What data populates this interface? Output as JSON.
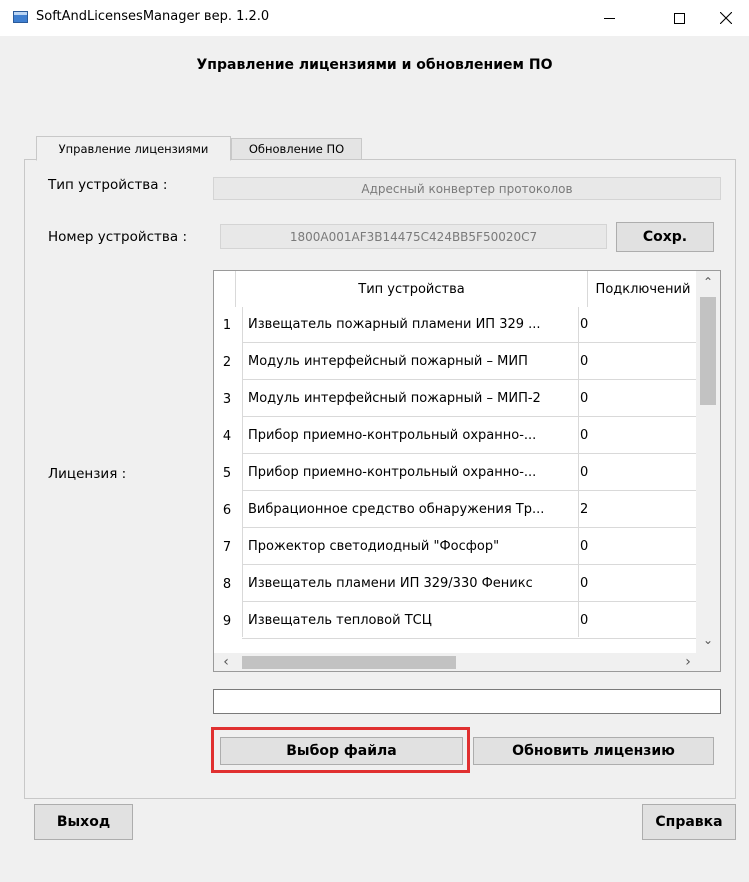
{
  "window": {
    "title": "SoftAndLicensesManager вер. 1.2.0"
  },
  "header": {
    "title": "Управление лицензиями и обновлением ПО"
  },
  "tabs": [
    {
      "label": "Управление лицензиями",
      "active": true
    },
    {
      "label": "Обновление ПО",
      "active": false
    }
  ],
  "form": {
    "device_type_label": "Тип устройства :",
    "device_type_value": "Адресный конвертер протоколов",
    "device_number_label": "Номер устройства :",
    "device_number_value": "1800A001AF3B14475C424BB5F50020C7",
    "save_label": "Сохр.",
    "license_label": "Лицензия :",
    "file_path_value": ""
  },
  "license_table": {
    "columns": [
      "Тип устройства",
      "Подключений"
    ],
    "rows": [
      {
        "n": "1",
        "type": "Извещатель пожарный пламени ИП 329 ...",
        "connections": "0"
      },
      {
        "n": "2",
        "type": "Модуль интерфейсный пожарный – МИП",
        "connections": "0"
      },
      {
        "n": "3",
        "type": "Модуль интерфейсный пожарный – МИП-2",
        "connections": "0"
      },
      {
        "n": "4",
        "type": "Прибор приемно-контрольный охранно-...",
        "connections": "0"
      },
      {
        "n": "5",
        "type": "Прибор приемно-контрольный охранно-...",
        "connections": "0"
      },
      {
        "n": "6",
        "type": "Вибрационное средство обнаружения Тр...",
        "connections": "2"
      },
      {
        "n": "7",
        "type": "Прожектор светодиодный \"Фосфор\"",
        "connections": "0"
      },
      {
        "n": "8",
        "type": "Извещатель пламени ИП 329/330 Феникс",
        "connections": "0"
      },
      {
        "n": "9",
        "type": "Извещатель тепловой ТСЦ",
        "connections": "0"
      }
    ]
  },
  "actions": {
    "choose_file_label": "Выбор файла",
    "update_license_label": "Обновить лицензию"
  },
  "footer": {
    "exit_label": "Выход",
    "help_label": "Справка"
  },
  "colors": {
    "highlight": "#e03030",
    "window_bg": "#f0f0f0"
  }
}
